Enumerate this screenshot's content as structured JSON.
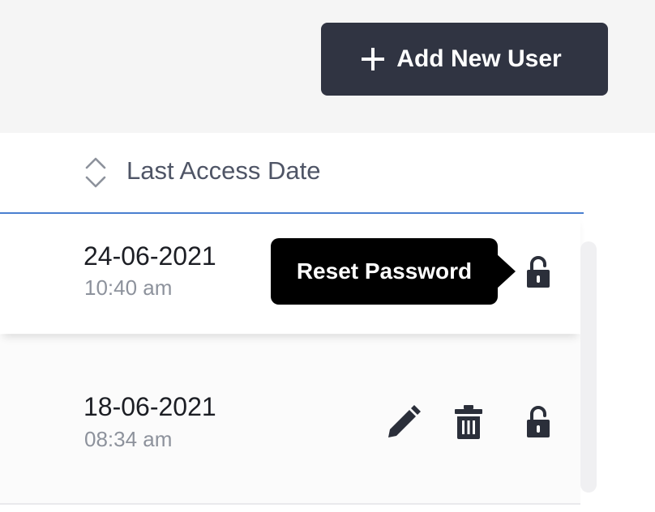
{
  "toolbar": {
    "add_user_label": "Add New User",
    "add_icon": "plus-icon"
  },
  "table": {
    "columns": [
      {
        "label": "Last Access Date",
        "sort_icon": "sort-icon"
      }
    ],
    "rows": [
      {
        "date": "24-06-2021",
        "time": "10:40 am",
        "actions": [
          "reset-password"
        ]
      },
      {
        "date": "18-06-2021",
        "time": "08:34 am",
        "actions": [
          "edit",
          "delete",
          "reset-password"
        ]
      }
    ]
  },
  "tooltip": {
    "text": "Reset Password"
  },
  "colors": {
    "button_bg": "#303442",
    "header_border": "#4a7fd0",
    "time_text": "#8d929c",
    "icon": "#2b2f3a"
  }
}
